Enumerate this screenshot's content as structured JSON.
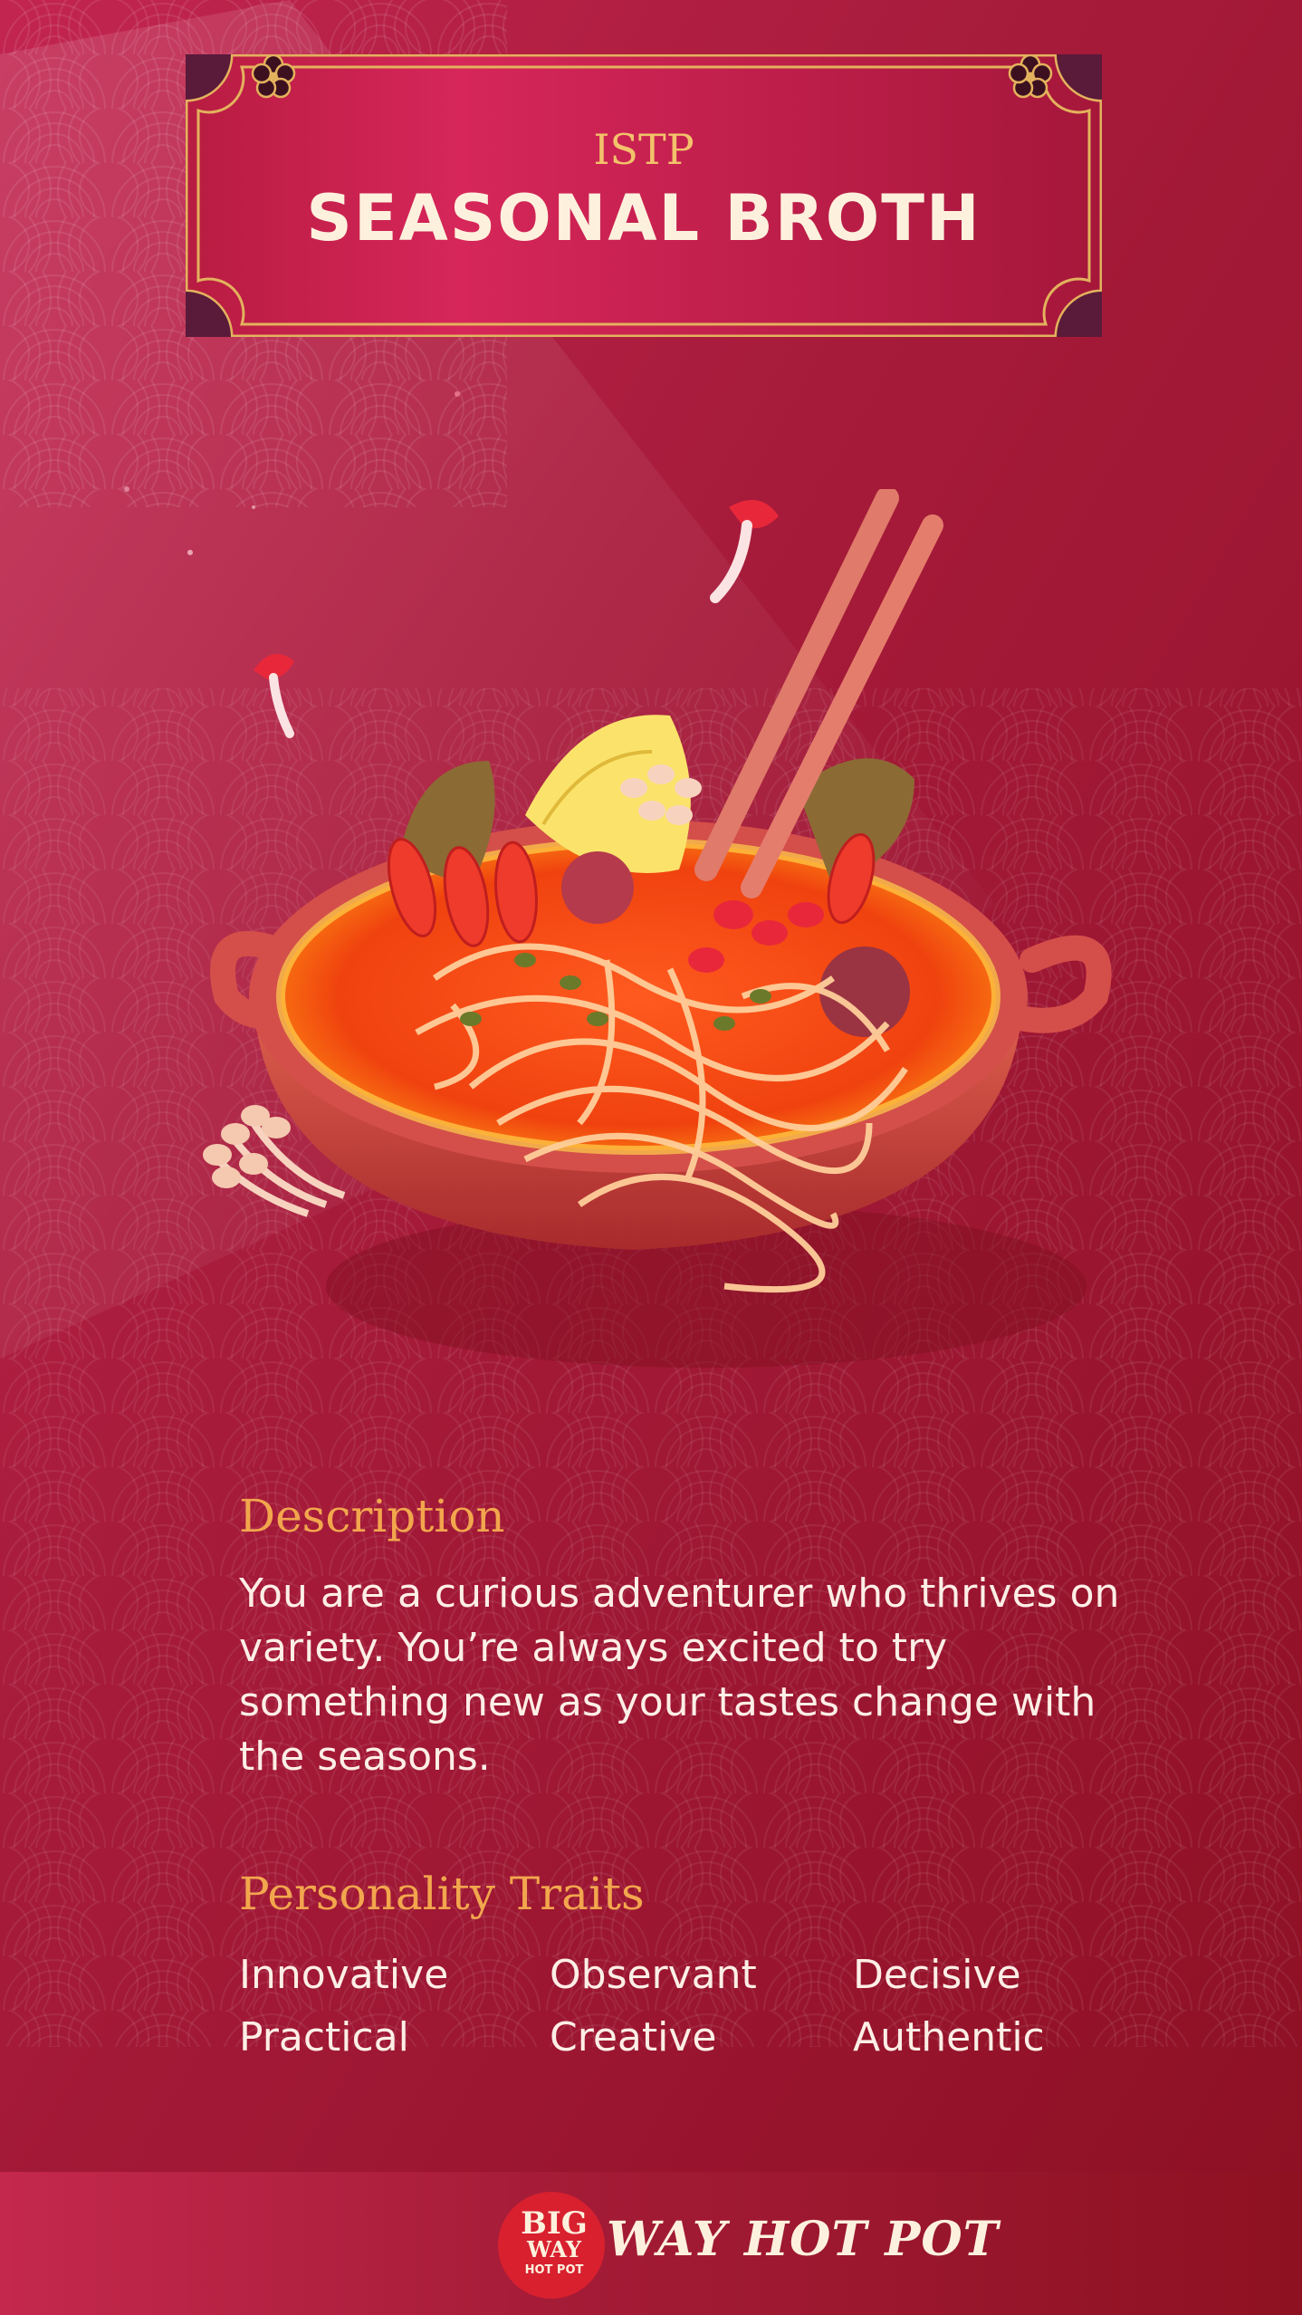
{
  "header": {
    "mbti_type": "ISTP",
    "broth_name": "SEASONAL BROTH"
  },
  "description": {
    "heading": "Description",
    "body": "You are a curious adventurer who thrives on variety. You’re always excited to try something new as your tastes change with the seasons."
  },
  "traits": {
    "heading": "Personality Traits",
    "items": [
      "Innovative",
      "Observant",
      "Decisive",
      "Practical",
      "Creative",
      "Authentic"
    ]
  },
  "footer": {
    "logo_text_big": "BIG",
    "logo_text_way": "WAY",
    "logo_text_hotpot": "HOT POT",
    "brand_name": "WAY HOT POT"
  },
  "colors": {
    "background": "#a61b3a",
    "plaque": "#c3204a",
    "gold": "#e3b25d",
    "heading_orange": "#f2a64d",
    "body_text": "#fdeee6",
    "footer": "#a31b36"
  },
  "icons": {
    "title_ornament": "plum-blossom-icon",
    "logo": "big-way-hot-pot-logo"
  }
}
